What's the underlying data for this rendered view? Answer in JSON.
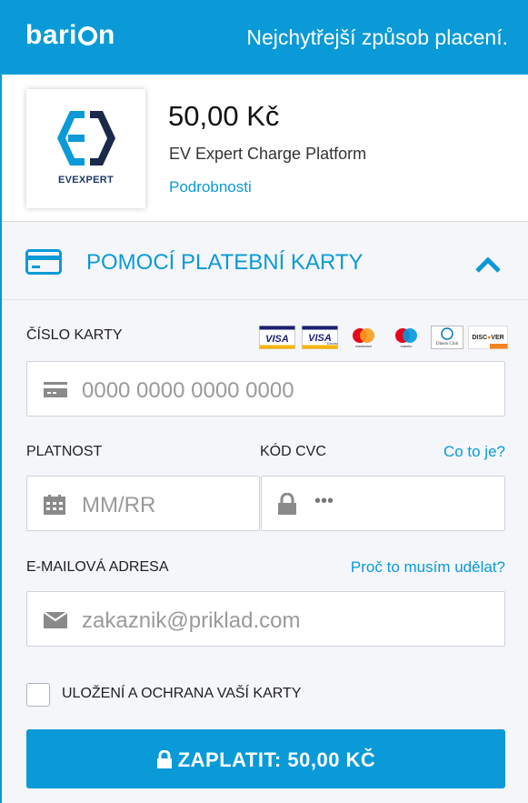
{
  "header": {
    "logo": "barion",
    "tagline": "Nejchytřejší způsob placení."
  },
  "merchant": {
    "logo_text": "EVEXPERT",
    "amount": "50,00 Kč",
    "name": "EV Expert Charge Platform",
    "details_link": "Podrobnosti"
  },
  "payment_method": {
    "label": "POMOCÍ PLATEBNÍ KARTY",
    "icon": "credit-card-icon",
    "expanded": true
  },
  "form": {
    "card_number_label": "ČÍSLO KARTY",
    "card_number_placeholder": "0000 0000 0000 0000",
    "card_brands": [
      {
        "name": "VISA",
        "color": "#1a1f71"
      },
      {
        "name": "VISA Electron",
        "color": "#1a1f71"
      },
      {
        "name": "Mastercard",
        "color": "#eb001b"
      },
      {
        "name": "Maestro",
        "color": "#0099df"
      },
      {
        "name": "Diners Club International",
        "color": "#0079be"
      },
      {
        "name": "DISCOVER",
        "color": "#f58220"
      }
    ],
    "expiry_label": "PLATNOST",
    "expiry_placeholder": "MM/RR",
    "cvc_label": "KÓD CVC",
    "cvc_help_link": "Co to je?",
    "cvc_placeholder": "•••",
    "email_label": "E-MAILOVÁ ADRESA",
    "email_help_link": "Proč to musím udělat?",
    "email_placeholder": "zakaznik@priklad.com",
    "save_card_label": "ULOŽENÍ A OCHRANA VAŠÍ KARTY",
    "save_card_checked": false,
    "pay_button_label": "ZAPLATIT: 50,00 KČ"
  },
  "colors": {
    "brand_blue": "#0a9ad7",
    "panel_bg": "#f4f6f9"
  }
}
